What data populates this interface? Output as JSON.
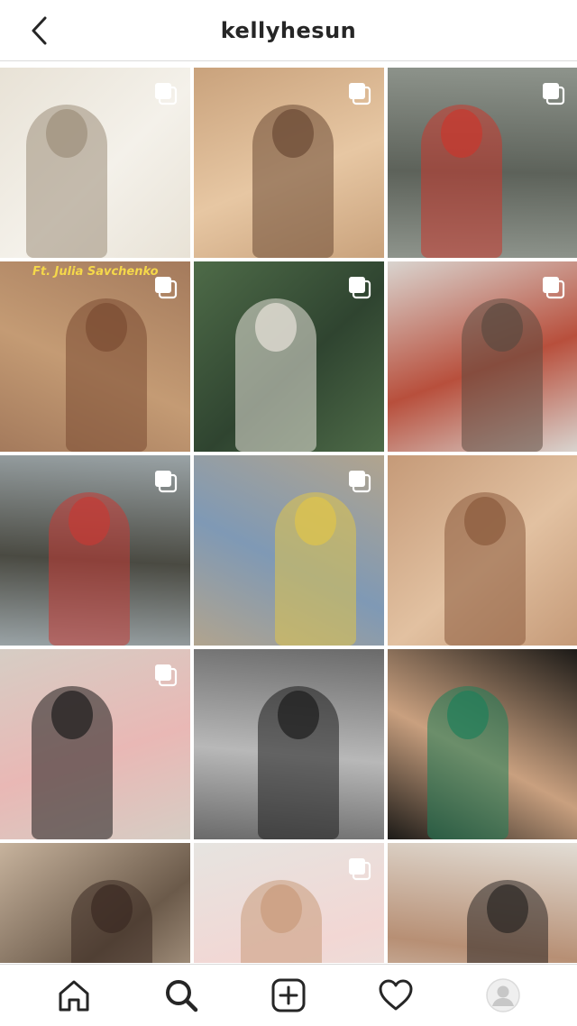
{
  "header": {
    "title": "kellyhesun",
    "back_icon": "chevron-left-icon"
  },
  "grid": {
    "posts": [
      {
        "palette": [
          "#e8e2d6",
          "#9c8e7a",
          "#f4f1ea"
        ],
        "multi": true,
        "caption": ""
      },
      {
        "palette": [
          "#c9a27c",
          "#6b4a34",
          "#e7c7a3"
        ],
        "multi": true,
        "caption": ""
      },
      {
        "palette": [
          "#8e948c",
          "#c9382e",
          "#5d625a"
        ],
        "multi": true,
        "caption": ""
      },
      {
        "palette": [
          "#a47a5c",
          "#7a4b32",
          "#c49b74"
        ],
        "multi": true,
        "caption": "Ft. Julia Savchenko"
      },
      {
        "palette": [
          "#4e6b48",
          "#e8e3da",
          "#2f4430"
        ],
        "multi": true,
        "caption": ""
      },
      {
        "palette": [
          "#d9d4cf",
          "#5c4a40",
          "#b84f3c"
        ],
        "multi": true,
        "caption": ""
      },
      {
        "palette": [
          "#9aa3a6",
          "#c43a34",
          "#4a4a42"
        ],
        "multi": true,
        "caption": ""
      },
      {
        "palette": [
          "#b1a48e",
          "#e0c44a",
          "#7f99b5"
        ],
        "multi": true,
        "caption": ""
      },
      {
        "palette": [
          "#c59a78",
          "#8a5a3c",
          "#e2c1a1"
        ],
        "multi": false,
        "caption": ""
      },
      {
        "palette": [
          "#d6cdc4",
          "#1e1c1c",
          "#e9b8b5"
        ],
        "multi": true,
        "caption": ""
      },
      {
        "palette": [
          "#6a6a6a",
          "#1d1d1d",
          "#b8b8b8"
        ],
        "multi": false,
        "caption": ""
      },
      {
        "palette": [
          "#1c1a17",
          "#1f7f5a",
          "#c9a07f"
        ],
        "multi": false,
        "caption": ""
      },
      {
        "palette": [
          "#c7b39d",
          "#3a2a22",
          "#6b5a4a"
        ],
        "multi": false,
        "caption": ""
      },
      {
        "palette": [
          "#e6e4e0",
          "#c99a7a",
          "#f2d7d4"
        ],
        "multi": true,
        "caption": ""
      },
      {
        "palette": [
          "#e2ddd5",
          "#2b2624",
          "#b78f74"
        ],
        "multi": false,
        "caption": ""
      }
    ]
  },
  "bottom_nav": {
    "items": [
      {
        "name": "home-icon"
      },
      {
        "name": "search-icon"
      },
      {
        "name": "new-post-icon"
      },
      {
        "name": "heart-icon"
      },
      {
        "name": "profile-avatar-icon"
      }
    ]
  },
  "colors": {
    "text": "#262626",
    "border": "#dbdbdb",
    "background": "#ffffff"
  }
}
